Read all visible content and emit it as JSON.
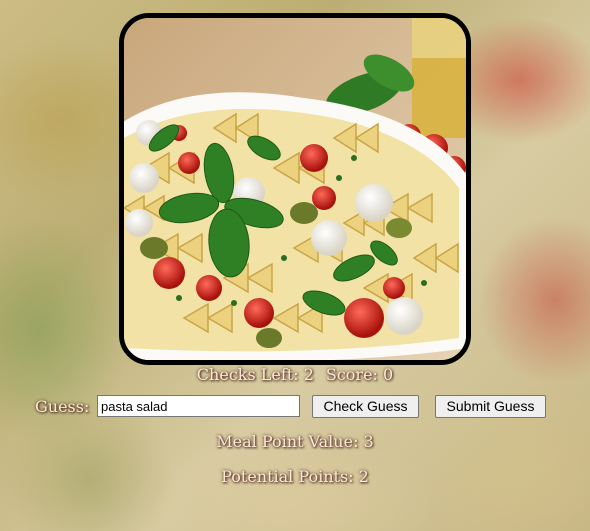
{
  "status": {
    "checks_left_label": "Checks Left: 2",
    "score_label": "Score: 0"
  },
  "guess": {
    "label": "Guess:",
    "input_value": "pasta salad",
    "check_button": "Check Guess",
    "submit_button": "Submit Guess"
  },
  "meal_point_value": "Meal Point Value: 3",
  "potential_points": "Potential Points: 2",
  "colors": {
    "label_text": "#ffe6d8",
    "frame_border": "#000000"
  }
}
